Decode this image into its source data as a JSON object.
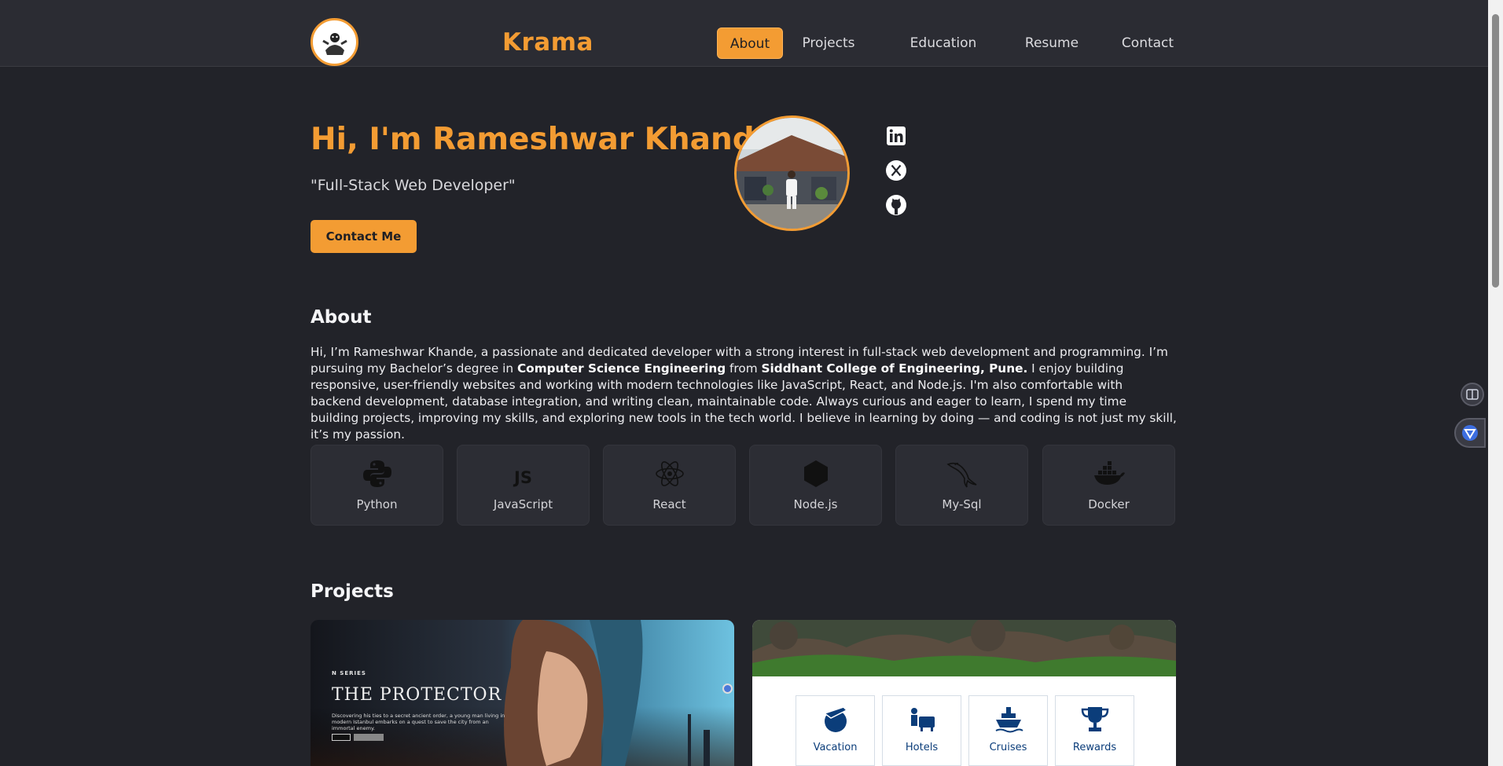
{
  "header": {
    "brand": "Krama",
    "nav": [
      {
        "label": "About",
        "active": true
      },
      {
        "label": "Projects",
        "active": false
      },
      {
        "label": "Education",
        "active": false
      },
      {
        "label": "Resume",
        "active": false
      },
      {
        "label": "Contact",
        "active": false
      }
    ]
  },
  "hero": {
    "title": "Hi, I'm Rameshwar Khande",
    "subtitle": "\"Full-Stack Web Developer\"",
    "cta_label": "Contact Me",
    "social_icons": [
      "linkedin-icon",
      "x-twitter-icon",
      "github-icon"
    ]
  },
  "about": {
    "heading": "About",
    "p1": "Hi, I’m Rameshwar Khande, a passionate and dedicated developer with a strong interest in full-stack web development and programming. I’m pursuing my Bachelor’s degree in ",
    "b1": "Computer Science Engineering",
    "p2": " from ",
    "b2": "Siddhant College of Engineering, Pune.",
    "p3": " I enjoy building responsive, user-friendly websites and working with modern technologies like JavaScript, React, and Node.js. I'm also comfortable with backend development, database integration, and writing clean, maintainable code. Always curious and eager to learn, I spend my time building projects, improving my skills, and exploring new tools in the tech world. I believe in learning by doing — and coding is not just my skill, it’s my passion.",
    "skills": [
      {
        "label": "Python",
        "icon": "python-icon"
      },
      {
        "label": "JavaScript",
        "icon": "js-icon",
        "icon_text": "JS"
      },
      {
        "label": "React",
        "icon": "react-icon"
      },
      {
        "label": "Node.js",
        "icon": "nodejs-icon"
      },
      {
        "label": "My-Sql",
        "icon": "mysql-icon"
      },
      {
        "label": "Docker",
        "icon": "docker-icon"
      }
    ]
  },
  "projects": {
    "heading": "Projects",
    "cards": [
      {
        "badge": "N SERIES",
        "title": "THE PROTECTOR",
        "blurb": "Discovering his ties to a secret ancient order, a young man living in modern Istanbul embarks on a quest to save the city from an immortal enemy."
      },
      {
        "tiles": [
          "Vacation",
          "Hotels",
          "Cruises",
          "Rewards"
        ]
      }
    ]
  },
  "colors": {
    "accent": "#f39c33",
    "background": "#222329",
    "card": "#2c2d34"
  }
}
